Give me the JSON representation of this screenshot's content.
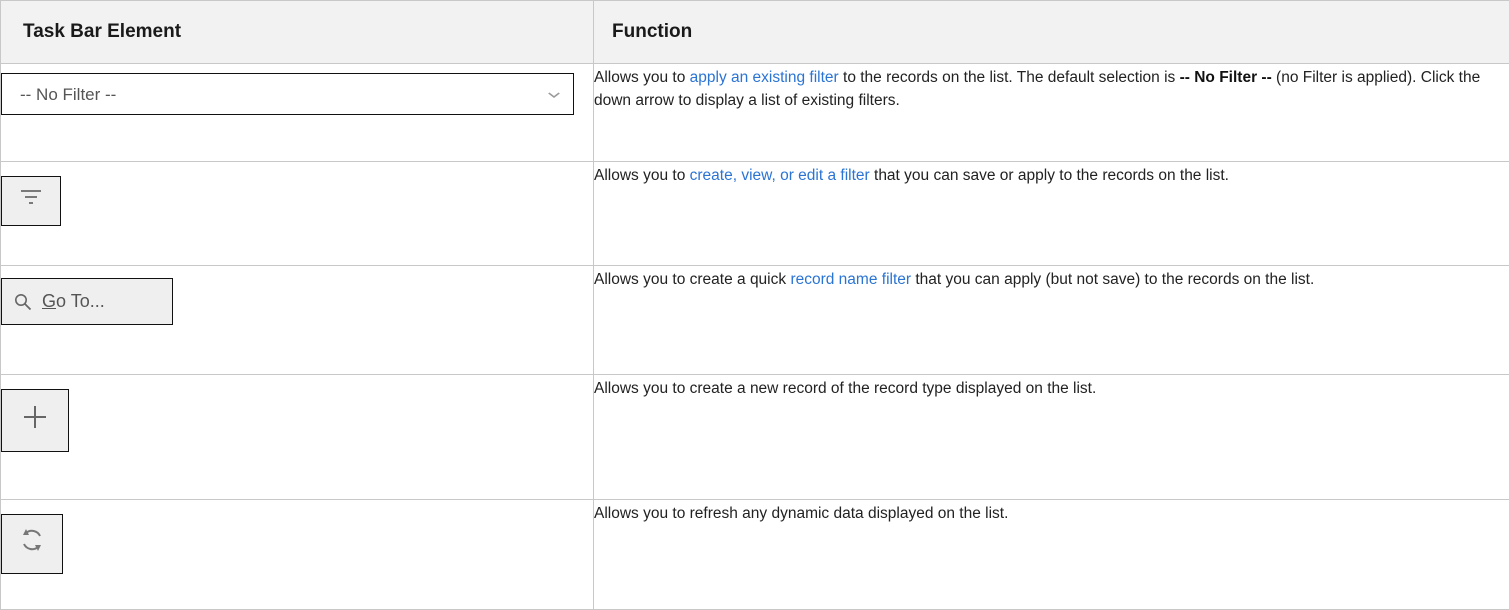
{
  "header": {
    "element_col": "Task Bar Element",
    "function_col": "Function"
  },
  "rows": [
    {
      "element": {
        "type": "select",
        "value": "-- No Filter --",
        "icon": "chevron-down-icon"
      },
      "text_before": "Allows you to ",
      "link": "apply an existing filter",
      "text_mid": " to the records on the list. The default selection is ",
      "bold": "-- No Filter --",
      "text_after": " (no Filter is applied). Click the down arrow to display a list of existing filters."
    },
    {
      "element": {
        "type": "button",
        "icon": "filter-icon"
      },
      "text_before": "Allows you to ",
      "link": "create, view, or edit a filter",
      "text_after": " that you can save or apply to the records on the list."
    },
    {
      "element": {
        "type": "button",
        "icon": "search-icon",
        "label_underlined": "G",
        "label_rest": "o To..."
      },
      "text_before": "Allows you to create a quick ",
      "link": "record name filter",
      "text_after": " that you can apply (but not save) to the records on the list."
    },
    {
      "element": {
        "type": "button",
        "icon": "plus-icon"
      },
      "text": "Allows you to create a new record of the record type displayed on the list."
    },
    {
      "element": {
        "type": "button",
        "icon": "refresh-icon"
      },
      "text": "Allows you to refresh any dynamic data displayed on the list."
    }
  ],
  "colors": {
    "link": "#2a74d4",
    "header_bg": "#f2f2f2",
    "button_bg": "#efefef",
    "border": "#c8c8c8"
  }
}
